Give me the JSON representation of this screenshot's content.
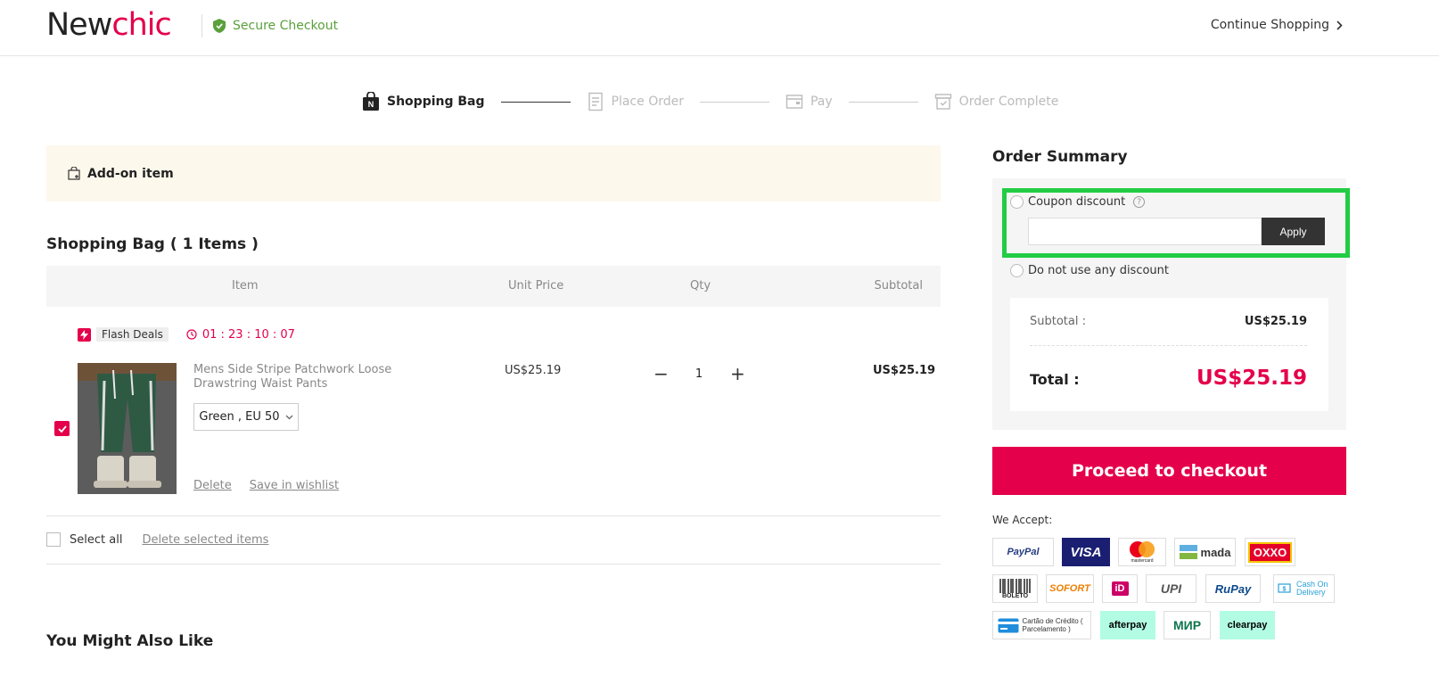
{
  "header": {
    "logo_part1": "New",
    "logo_part2": "chic",
    "secure_label": "Secure Checkout",
    "continue_label": "Continue Shopping"
  },
  "steps": [
    {
      "label": "Shopping Bag",
      "active": true
    },
    {
      "label": "Place Order",
      "active": false
    },
    {
      "label": "Pay",
      "active": false
    },
    {
      "label": "Order Complete",
      "active": false
    }
  ],
  "addon": {
    "label": "Add-on item"
  },
  "bag": {
    "title": "Shopping Bag ( 1 Items )",
    "columns": [
      "Item",
      "Unit Price",
      "Qty",
      "Subtotal"
    ],
    "flash_label": "Flash Deals",
    "countdown": "01 : 23 : 10 : 07",
    "item": {
      "name": "Mens Side Stripe Patchwork Loose Drawstring Waist Pants",
      "variant": "Green , EU 50",
      "unit_price": "US$25.19",
      "qty": "1",
      "subtotal": "US$25.19",
      "delete": "Delete",
      "wishlist": "Save in wishlist"
    },
    "select_all": "Select all",
    "delete_selected": "Delete selected items"
  },
  "recommend": {
    "title": "You Might Also Like"
  },
  "summary": {
    "title": "Order Summary",
    "coupon_label": "Coupon discount",
    "coupon_value": "",
    "apply_label": "Apply",
    "no_discount_label": "Do not use any discount",
    "subtotal_label": "Subtotal :",
    "subtotal_value": "US$25.19",
    "total_label": "Total :",
    "total_value": "US$25.19",
    "checkout_label": "Proceed to checkout",
    "we_accept": "We Accept:"
  },
  "payments": [
    {
      "name": "PayPal",
      "icon": "paypal-icon"
    },
    {
      "name": "VISA",
      "icon": "visa-icon"
    },
    {
      "name": "mastercard",
      "icon": "mastercard-icon"
    },
    {
      "name": "mada",
      "icon": "mada-icon"
    },
    {
      "name": "OXXO",
      "icon": "oxxo-icon"
    },
    {
      "name": "BOLETO",
      "icon": "boleto-icon"
    },
    {
      "name": "SOFORT",
      "icon": "sofort-icon"
    },
    {
      "name": "iD",
      "icon": "ideal-icon"
    },
    {
      "name": "UPI",
      "icon": "upi-icon"
    },
    {
      "name": "RuPay",
      "icon": "rupay-icon"
    },
    {
      "name": "Cash On Delivery",
      "icon": "cod-icon"
    },
    {
      "name": "Cartão de Crédito ( Parcelamento )",
      "icon": "card-icon"
    },
    {
      "name": "afterpay",
      "icon": "afterpay-icon"
    },
    {
      "name": "МИР",
      "icon": "mir-icon"
    },
    {
      "name": "clearpay",
      "icon": "clearpay-icon"
    }
  ],
  "colors": {
    "brand": "#e4004b",
    "secure": "#5aa03c",
    "highlight": "#22cc44"
  }
}
